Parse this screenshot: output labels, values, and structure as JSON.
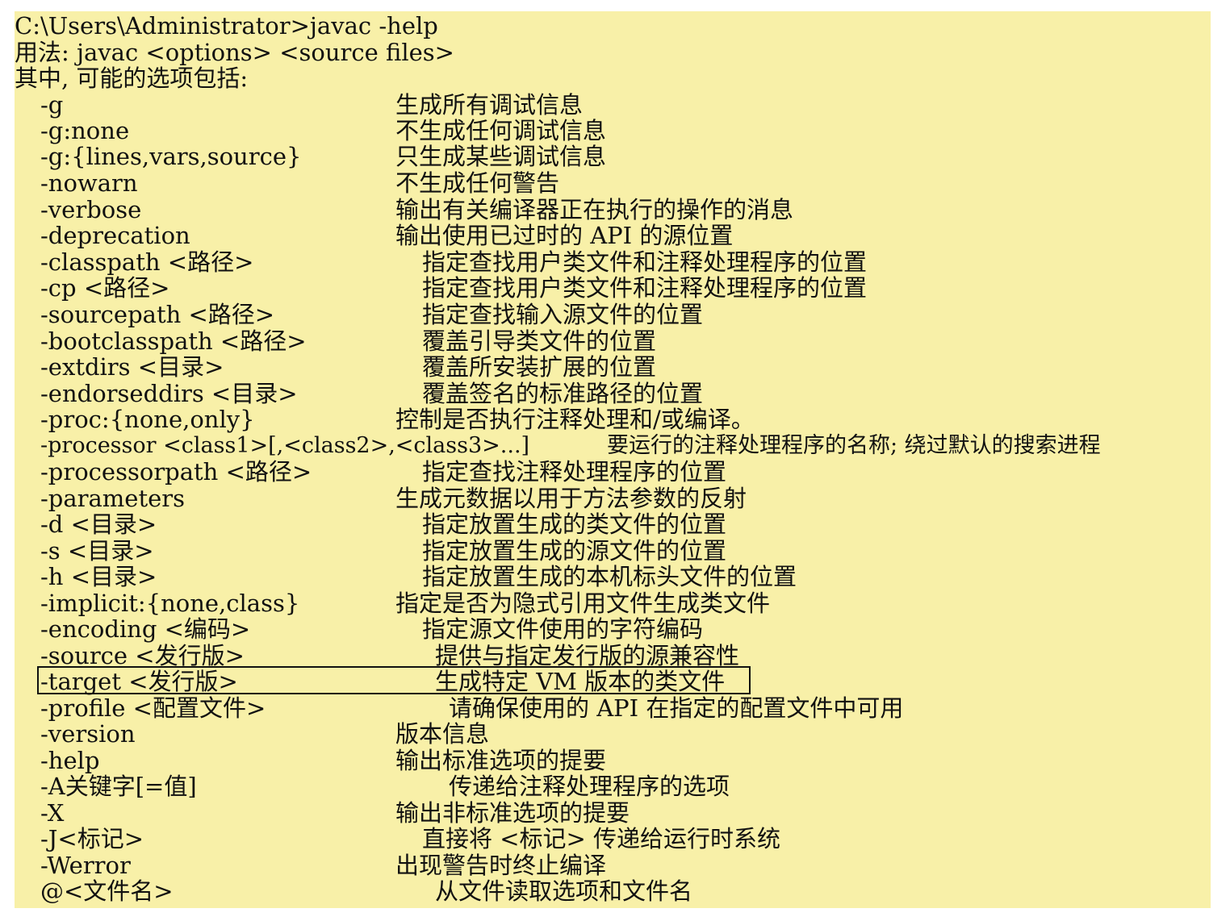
{
  "console": {
    "background": "#f8f0a8",
    "prompt_line": "C:\\Users\\Administrator>javac -help",
    "usage_line": "用法: javac <options> <source files>",
    "intro_line": "其中, 可能的选项包括:",
    "highlighted_option": "-target <发行版>",
    "options": [
      {
        "opt": "-g",
        "desc": "生成所有调试信息"
      },
      {
        "opt": "-g:none",
        "desc": "不生成任何调试信息"
      },
      {
        "opt": "-g:{lines,vars,source}",
        "desc": "只生成某些调试信息"
      },
      {
        "opt": "-nowarn",
        "desc": "不生成任何警告"
      },
      {
        "opt": "-verbose",
        "desc": "输出有关编译器正在执行的操作的消息"
      },
      {
        "opt": "-deprecation",
        "desc": "输出使用已过时的 API 的源位置"
      },
      {
        "opt": "-classpath <路径>",
        "desc": "指定查找用户类文件和注释处理程序的位置"
      },
      {
        "opt": "-cp <路径>",
        "desc": "指定查找用户类文件和注释处理程序的位置"
      },
      {
        "opt": "-sourcepath <路径>",
        "desc": "指定查找输入源文件的位置"
      },
      {
        "opt": "-bootclasspath <路径>",
        "desc": "覆盖引导类文件的位置"
      },
      {
        "opt": "-extdirs <目录>",
        "desc": "覆盖所安装扩展的位置"
      },
      {
        "opt": "-endorseddirs <目录>",
        "desc": "覆盖签名的标准路径的位置"
      },
      {
        "opt": "-proc:{none,only}",
        "desc": "控制是否执行注释处理和/或编译。"
      },
      {
        "opt": "-processor <class1>[,<class2>,<class3>...]",
        "desc": "要运行的注释处理程序的名称; 绕过默认的搜索进程"
      },
      {
        "opt": "-processorpath <路径>",
        "desc": "指定查找注释处理程序的位置"
      },
      {
        "opt": "-parameters",
        "desc": "生成元数据以用于方法参数的反射"
      },
      {
        "opt": "-d <目录>",
        "desc": "指定放置生成的类文件的位置"
      },
      {
        "opt": "-s <目录>",
        "desc": "指定放置生成的源文件的位置"
      },
      {
        "opt": "-h <目录>",
        "desc": "指定放置生成的本机标头文件的位置"
      },
      {
        "opt": "-implicit:{none,class}",
        "desc": "指定是否为隐式引用文件生成类文件"
      },
      {
        "opt": "-encoding <编码>",
        "desc": "指定源文件使用的字符编码"
      },
      {
        "opt": "-source <发行版>",
        "desc": "提供与指定发行版的源兼容性"
      },
      {
        "opt": "-target <发行版>",
        "desc": "生成特定 VM 版本的类文件"
      },
      {
        "opt": "-profile <配置文件>",
        "desc": "请确保使用的 API 在指定的配置文件中可用"
      },
      {
        "opt": "-version",
        "desc": "版本信息"
      },
      {
        "opt": "-help",
        "desc": "输出标准选项的提要"
      },
      {
        "opt": "-A关键字[=值]",
        "desc": "传递给注释处理程序的选项"
      },
      {
        "opt": "-X",
        "desc": "输出非标准选项的提要"
      },
      {
        "opt": "-J<标记>",
        "desc": "直接将 <标记> 传递给运行时系统"
      },
      {
        "opt": "-Werror",
        "desc": "出现警告时终止编译"
      },
      {
        "opt": "@<文件名>",
        "desc": "从文件读取选项和文件名"
      }
    ]
  }
}
